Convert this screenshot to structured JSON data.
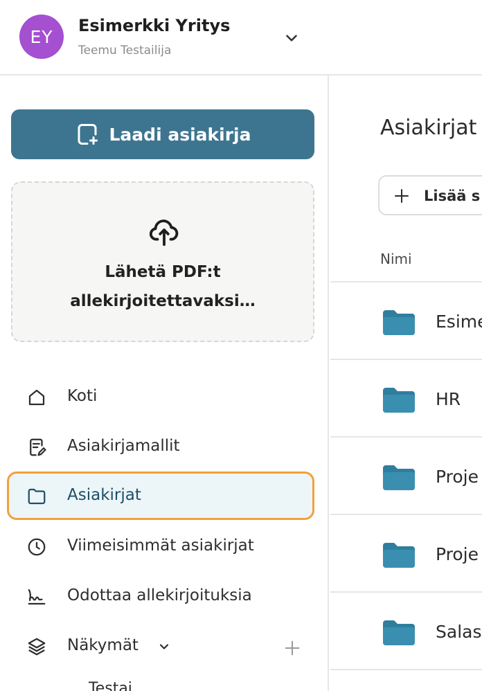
{
  "header": {
    "avatar_initials": "EY",
    "avatar_color": "#a54fd1",
    "company_name": "Esimerkki Yritys",
    "user_name": "Teemu Testailija"
  },
  "sidebar": {
    "compose_label": "Laadi asiakirja",
    "compose_color": "#3d7590",
    "dropzone_text": "Lähetä PDF:t allekirjoitettavaksi…",
    "items": [
      {
        "label": "Koti",
        "icon": "home-icon"
      },
      {
        "label": "Asiakirjamallit",
        "icon": "template-icon"
      },
      {
        "label": "Asiakirjat",
        "icon": "folder-icon",
        "active": true
      },
      {
        "label": "Viimeisimmät asiakirjat",
        "icon": "clock-icon"
      },
      {
        "label": "Odottaa allekirjoituksia",
        "icon": "signature-icon"
      },
      {
        "label": "Näkymät",
        "icon": "layers-icon"
      }
    ],
    "cut_off_item": "Testai"
  },
  "main": {
    "title": "Asiakirjat",
    "add_button_label": "Lisää s",
    "column_name": "Nimi",
    "folders": [
      "Esime",
      "HR",
      "Proje",
      "Proje",
      "Salas"
    ]
  },
  "colors": {
    "accent": "#3d7590",
    "active_highlight": "#f2a13a",
    "active_bg": "#ecf5f8",
    "folder": "#2f7e9e"
  }
}
